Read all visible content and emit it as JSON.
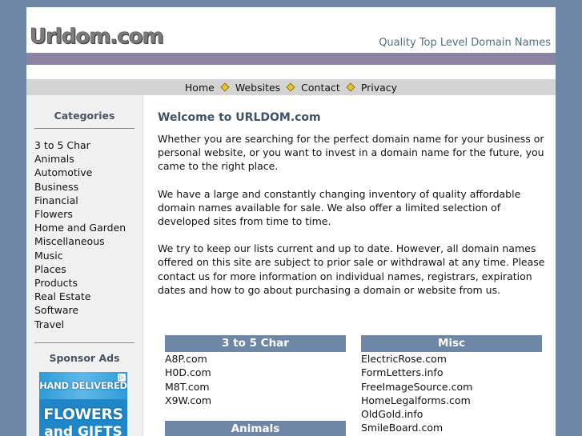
{
  "header": {
    "logo": "Urldom.com",
    "tagline": "Quality Top Level Domain Names"
  },
  "nav": {
    "items": [
      "Home",
      "Websites",
      "Contact",
      "Privacy"
    ]
  },
  "sidebar": {
    "categories_heading": "Categories",
    "categories": [
      "3 to 5 Char",
      "Animals",
      "Automotive",
      "Business",
      "Financial",
      "Flowers",
      "Home and Garden",
      "Miscellaneous",
      "Music",
      "Places",
      "Products",
      "Real Estate",
      "Software",
      "Travel"
    ],
    "sponsor_heading": "Sponsor Ads",
    "ad": {
      "line1": "HAND DELIVERED",
      "line2": "FLOWERS",
      "line3": "and GIFTS"
    }
  },
  "main": {
    "title": "Welcome to URLDOM.com",
    "paragraphs": [
      "Whether you are searching for the perfect domain name for your business or personal website, or you want to invest in a domain name for the future, you came to the right place.",
      "We have a large and constantly changing inventory of quality affordable domain names available for sale. We also offer a limited selection of developed sites from time to time.",
      "We try to keep our lists current and up to date. However, all domain names offered on this site are subject to prior sale or withdrawal at any time. Please contact us for more information on individual names, registrars, expiration dates and how to go about purchasing a domain or website from us."
    ]
  },
  "lists": {
    "col1": {
      "heading": "3 to 5 Char",
      "items": [
        "A8P.com",
        "H0D.com",
        "M8T.com",
        "X9W.com"
      ]
    },
    "col1b": {
      "heading": "Animals"
    },
    "col2": {
      "heading": "Misc",
      "items": [
        "ElectricRose.com",
        "FormLetters.info",
        "FreeImageSource.com",
        "HomeLegalforms.com",
        "OldGold.info",
        "SmileBoard.com"
      ]
    }
  },
  "colors": {
    "background": "#6f87a6",
    "band": "#8a83a4",
    "navbar": "#d4d4d4",
    "list_header": "#6f87a6"
  }
}
